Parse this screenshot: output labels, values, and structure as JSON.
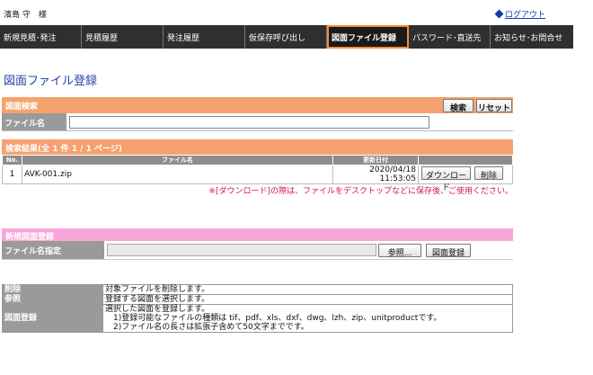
{
  "header": {
    "user_name": "濱島 守　様",
    "logout_label": "ログアウト"
  },
  "nav": {
    "tabs": [
      {
        "label": "新規見積･発注"
      },
      {
        "label": "見積履歴"
      },
      {
        "label": "発注履歴"
      },
      {
        "label": "仮保存呼び出し"
      },
      {
        "label": "図面ファイル登録",
        "active": true
      },
      {
        "label": "パスワード･直送先"
      },
      {
        "label": "お知らせ･お問合せ"
      }
    ]
  },
  "page_title": "図面ファイル登録",
  "search": {
    "header": "図面検索",
    "search_button": "検索",
    "reset_button": "リセット",
    "file_name_label": "ファイル名",
    "file_name_value": ""
  },
  "results": {
    "header": "検索結果(全 1 件 1 / 1 ページ)",
    "columns": {
      "no": "No.",
      "file_name": "ファイル名",
      "updated": "更新日付"
    },
    "rows": [
      {
        "no": "1",
        "file_name": "AVK-001.zip",
        "updated": "2020/04/18 11:53:05",
        "download_label": "ダウンロード",
        "delete_label": "削除"
      }
    ],
    "note": "※[ダウンロード]の際は、ファイルをデスクトップなどに保存後、ご使用ください。"
  },
  "register": {
    "header": "新規図面登録",
    "file_label": "ファイル名指定",
    "file_value": "",
    "browse_button": "参照...",
    "register_button": "図面登録"
  },
  "legend": {
    "rows": [
      {
        "key": "削除",
        "lines": [
          "対象ファイルを削除します。"
        ]
      },
      {
        "key": "参照",
        "lines": [
          "登録する図面を選択します。"
        ]
      },
      {
        "key": "図面登録",
        "lines": [
          "選択した図面を登録します。",
          "　1)登録可能なファイルの種類は tif、pdf、xls、dxf、dwg、lzh、zip、unitproductです。",
          "　2)ファイル名の長さは拡張子含めて50文字までです。"
        ]
      }
    ]
  }
}
